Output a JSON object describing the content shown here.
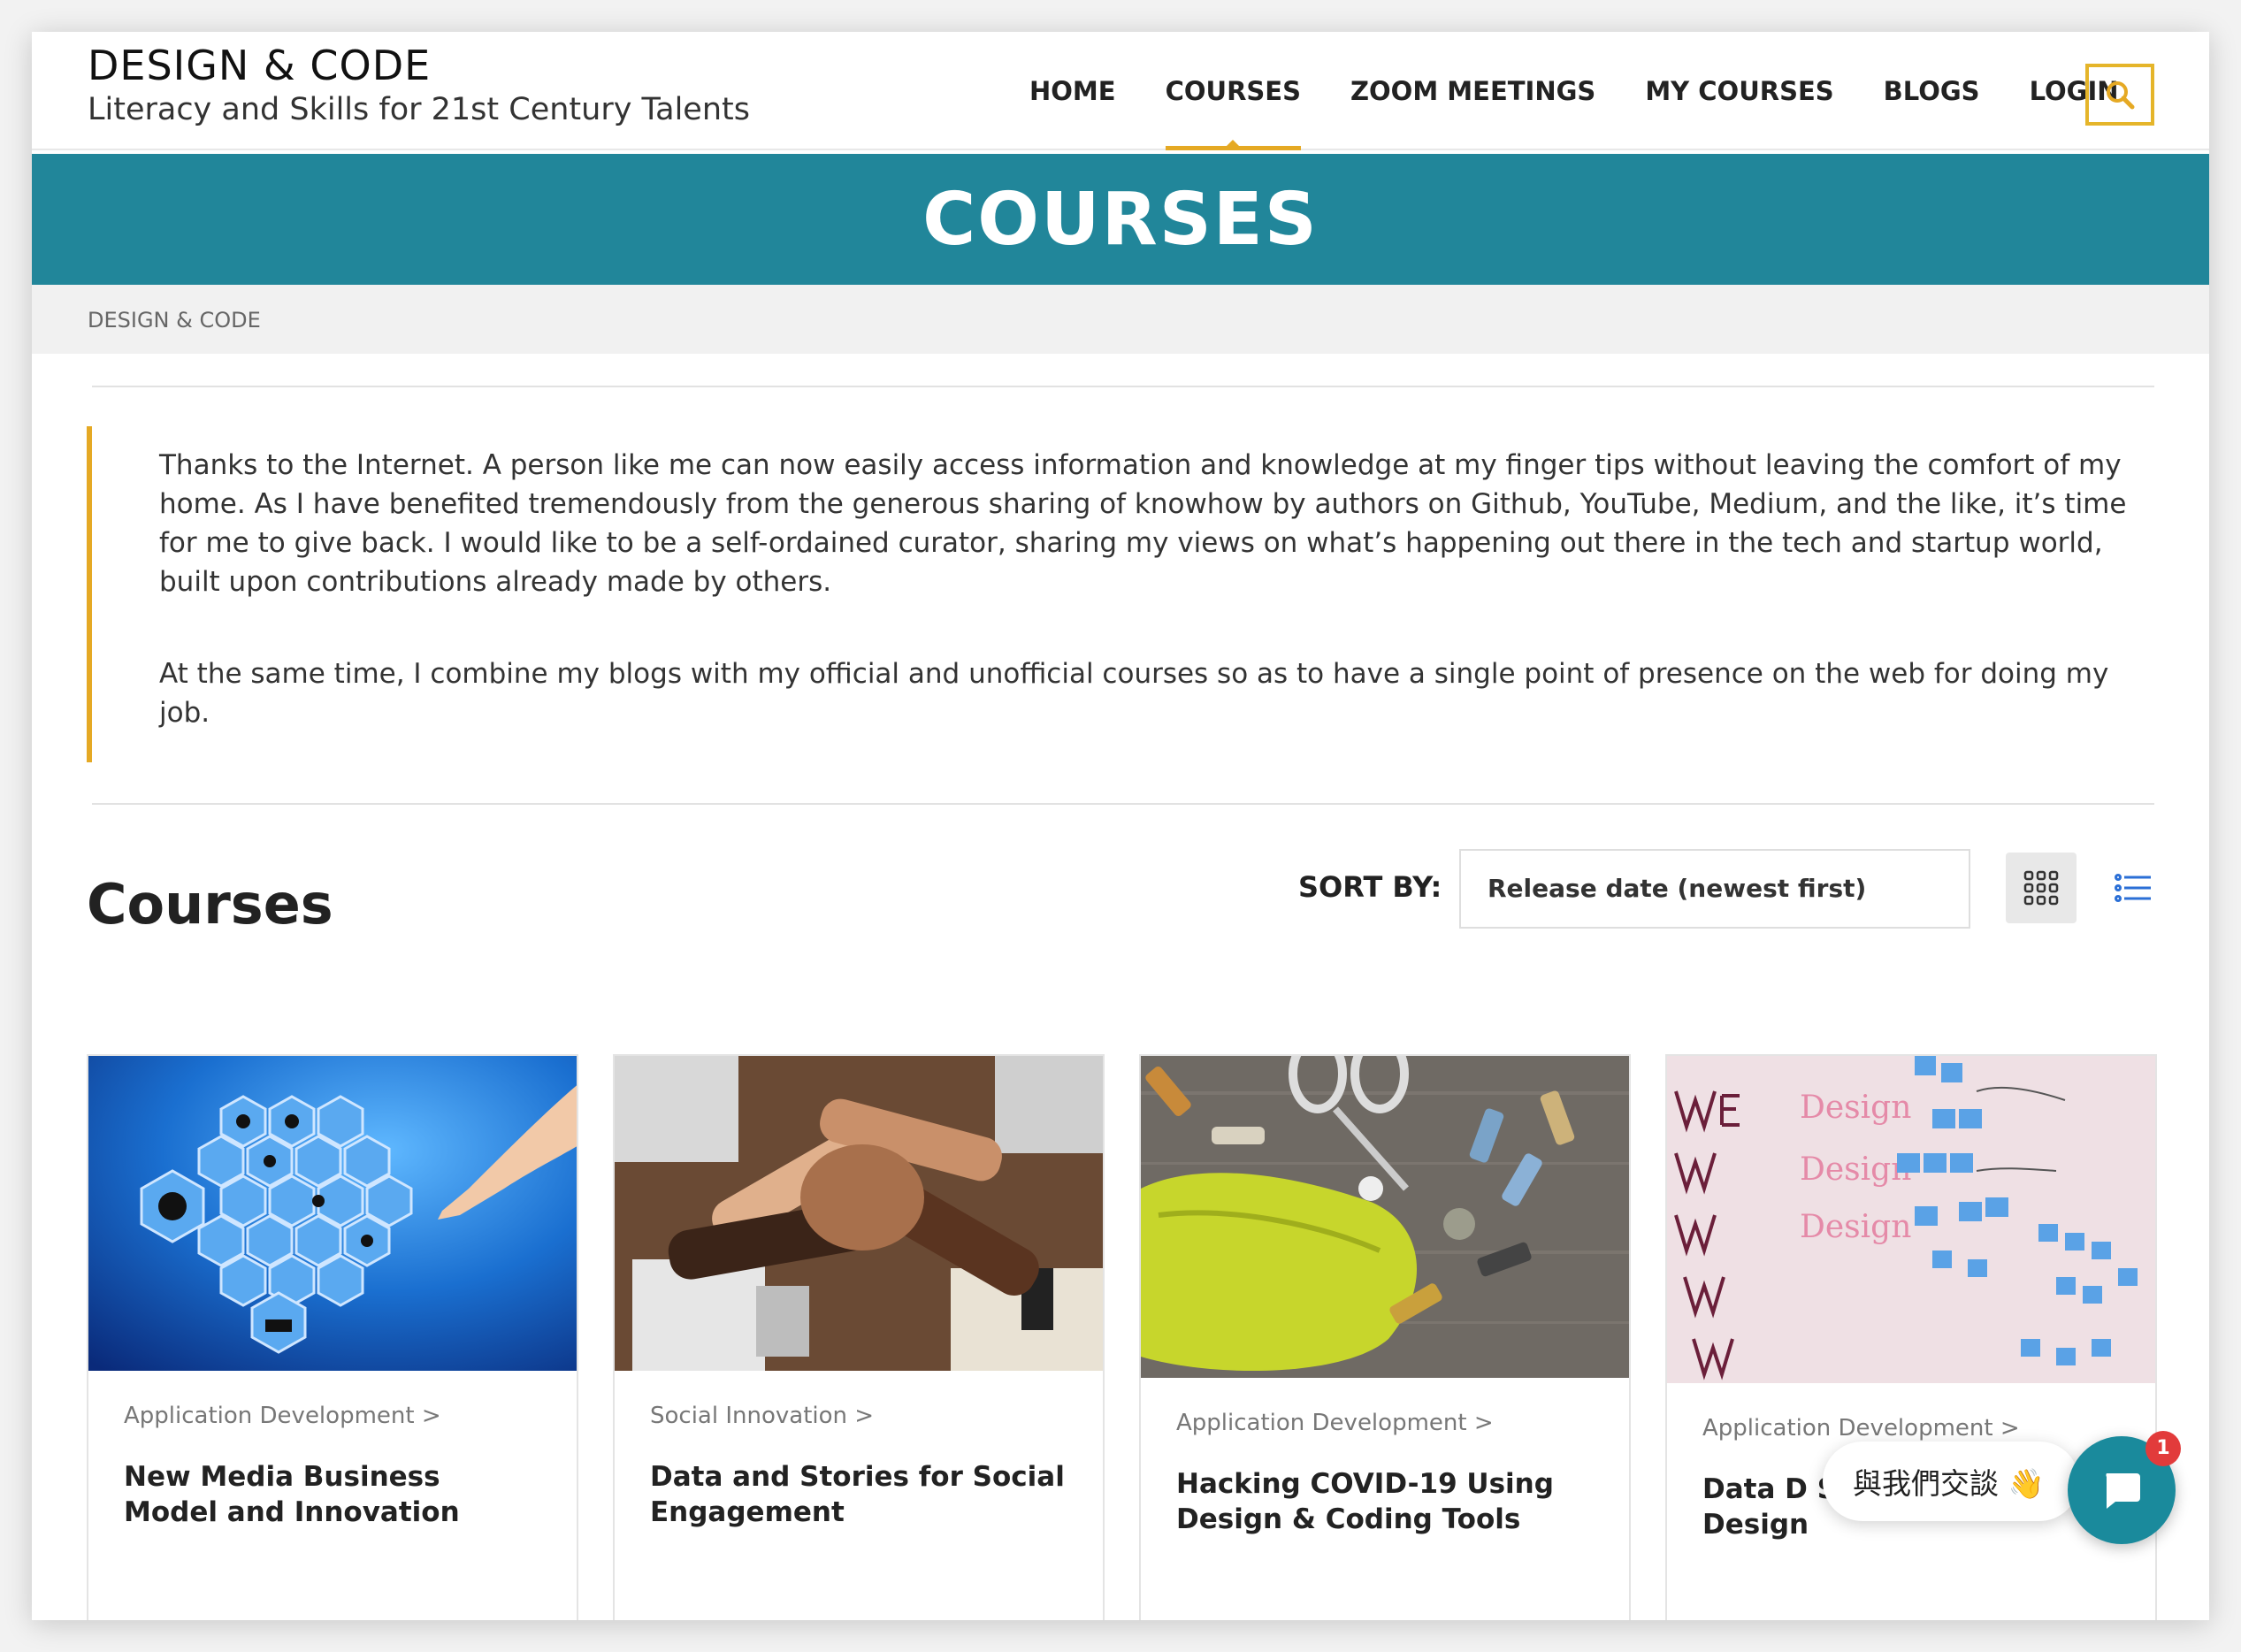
{
  "header": {
    "brand_title": "DESIGN & CODE",
    "brand_subtitle": "Literacy and Skills for 21st Century Talents",
    "nav": [
      {
        "label": "HOME",
        "active": false
      },
      {
        "label": "COURSES",
        "active": true
      },
      {
        "label": "ZOOM MEETINGS",
        "active": false
      },
      {
        "label": "MY COURSES",
        "active": false
      },
      {
        "label": "BLOGS",
        "active": false
      },
      {
        "label": "LOGIN",
        "active": false
      }
    ],
    "search_icon": "search-icon"
  },
  "banner": {
    "title": "COURSES"
  },
  "breadcrumb": {
    "text": "DESIGN & CODE"
  },
  "intro": {
    "paragraphs": [
      "Thanks to the Internet. A person like me can now easily access information and knowledge at my finger tips without leaving the comfort of my home. As I have benefited tremendously from the generous sharing of knowhow by authors on Github, YouTube, Medium, and the like, it’s time for me to give back. I would like to be a self-ordained curator, sharing my views on what’s happening out there in the tech and startup world, built upon contributions already made by others.",
      "At the same time, I combine my blogs with my official and unofficial courses so as to have a single point of presence on the web for doing my job."
    ]
  },
  "courses_section": {
    "title": "Courses",
    "sort_label": "SORT BY:",
    "sort_value": "Release date (newest first)",
    "view_modes": [
      "grid-view-icon",
      "list-view-icon"
    ]
  },
  "cards": [
    {
      "category": "Application Development >",
      "title": "New Media Business Model and Innovation",
      "image": "industry-4.0-hexagon-image"
    },
    {
      "category": "Social Innovation >",
      "title": "Data and Stories for Social Engagement",
      "image": "joined-hands-image"
    },
    {
      "category": "Application Development >",
      "title": "Hacking COVID-19 Using Design & Coding Tools",
      "image": "sewing-mask-image"
    },
    {
      "category": "Application Development >",
      "title": "Data D Service Design",
      "image": "whiteboard-weeks-image"
    }
  ],
  "chat": {
    "prompt": "與我們交談 👋",
    "badge_count": "1"
  },
  "colors": {
    "accent": "#e5a924",
    "banner": "#21869a",
    "chat": "#1a8a9c"
  }
}
